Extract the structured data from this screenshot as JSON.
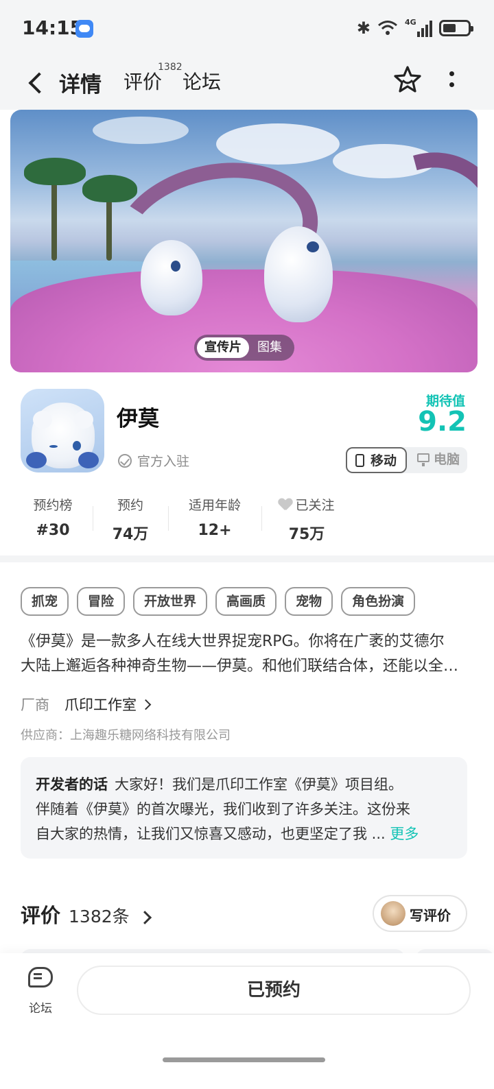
{
  "status_bar": {
    "time": "14:15",
    "network_tag": "4G"
  },
  "nav": {
    "tabs": [
      {
        "label": "详情",
        "active": true
      },
      {
        "label": "评价",
        "badge": "1382"
      },
      {
        "label": "论坛"
      }
    ]
  },
  "hero": {
    "media_tabs": [
      {
        "label": "宣传片",
        "active": true
      },
      {
        "label": "图集"
      }
    ]
  },
  "app": {
    "name": "伊莫",
    "official_label": "官方入驻",
    "expectation_label": "期待值",
    "expectation_score": "9.2",
    "platforms": [
      {
        "label": "移动",
        "active": true
      },
      {
        "label": "电脑"
      }
    ]
  },
  "stats": [
    {
      "label": "预约榜",
      "value": "#30"
    },
    {
      "label": "预约",
      "value": "74万"
    },
    {
      "label": "适用年龄",
      "value": "12+"
    },
    {
      "label": "已关注",
      "value": "75万"
    }
  ],
  "tags": [
    "抓宠",
    "冒险",
    "开放世界",
    "高画质",
    "宠物",
    "角色扮演"
  ],
  "description": {
    "line1": "《伊莫》是一款多人在线大世界捉宠RPG。你将在广袤的艾德尔",
    "line2": "大陆上邂逅各种神奇生物——伊莫。和他们联结合体，还能以全…"
  },
  "vendor": {
    "label": "厂商",
    "name": "爪印工作室"
  },
  "supplier": "供应商：上海趣乐糖网络科技有限公司",
  "developer_note": {
    "title": "开发者的话",
    "line1": "大家好！我们是爪印工作室《伊莫》项目组。",
    "line2": "伴随着《伊莫》的首次曝光，我们收到了许多关注。这份来",
    "line3": "自大家的热情，让我们又惊喜又感动，也更坚定了我 ...",
    "more": "更多"
  },
  "reviews": {
    "title": "评价",
    "count": "1382条",
    "write_label": "写评价"
  },
  "bottom": {
    "forum_label": "论坛",
    "reserve_label": "已预约"
  },
  "colors": {
    "accent": "#13c3b5",
    "tab_underline": "#13d3c1"
  }
}
